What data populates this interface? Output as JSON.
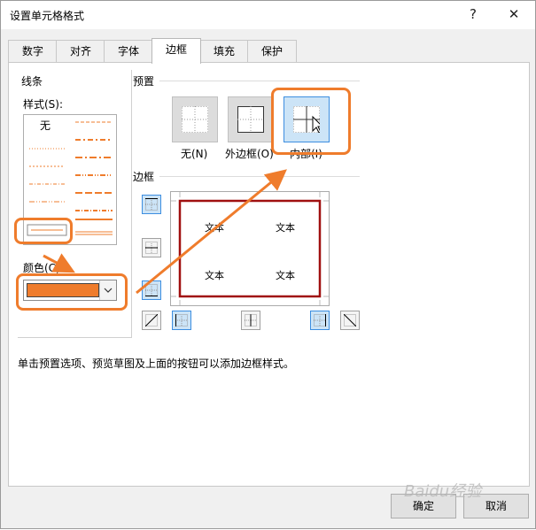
{
  "dialog": {
    "title": "设置单元格格式",
    "help_glyph": "?",
    "close_glyph": "✕"
  },
  "tabs": [
    {
      "label": "数字",
      "active": false
    },
    {
      "label": "对齐",
      "active": false
    },
    {
      "label": "字体",
      "active": false
    },
    {
      "label": "边框",
      "active": true
    },
    {
      "label": "填充",
      "active": false
    },
    {
      "label": "保护",
      "active": false
    }
  ],
  "line": {
    "group_label": "线条",
    "style_label": "样式(S):",
    "none_label": "无",
    "color_label": "颜色(C):",
    "color_value": "#ef7c2c"
  },
  "presets": {
    "group_label": "预置",
    "items": [
      {
        "label": "无(N)",
        "icon": "preset-none-icon",
        "selected": false
      },
      {
        "label": "外边框(O)",
        "icon": "preset-outline-icon",
        "selected": false
      },
      {
        "label": "内部(I)",
        "icon": "preset-inside-icon",
        "selected": true
      }
    ]
  },
  "border": {
    "group_label": "边框",
    "preview_text": [
      "文本",
      "文本",
      "文本",
      "文本"
    ],
    "preview_border_color": "#a01010"
  },
  "hint": "单击预置选项、预览草图及上面的按钮可以添加边框样式。",
  "buttons": {
    "ok": "确定",
    "cancel": "取消"
  },
  "watermark": "Baidu经验",
  "annotation_color": "#ef7c2c"
}
